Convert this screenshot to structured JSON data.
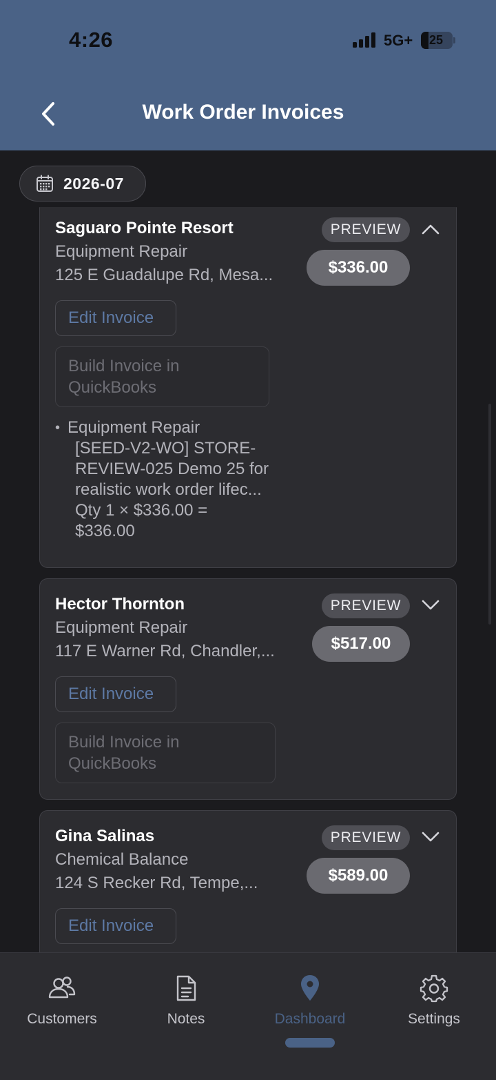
{
  "status_bar": {
    "time": "4:26",
    "network": "5G+",
    "battery": "25"
  },
  "header": {
    "title": "Work Order Invoices"
  },
  "filter": {
    "month": "2026-07"
  },
  "invoices": [
    {
      "name": "Saguaro Pointe Resort",
      "service": "Equipment Repair",
      "address": "125 E Guadalupe Rd, Mesa...",
      "status": "PREVIEW",
      "amount": "$336.00",
      "expanded": true,
      "edit_label": "Edit Invoice",
      "build_label": "Build Invoice in\nQuickBooks",
      "line_items": [
        {
          "title": "Equipment Repair",
          "detail": "[SEED-V2-WO] STORE-\nREVIEW-025 Demo 25 for\nrealistic work order lifec...\nQty 1 × $336.00 =\n$336.00"
        }
      ]
    },
    {
      "name": "Hector Thornton",
      "service": "Equipment Repair",
      "address": "117 E Warner Rd, Chandler,...",
      "status": "PREVIEW",
      "amount": "$517.00",
      "expanded": false,
      "edit_label": "Edit Invoice",
      "build_label": "Build Invoice in\nQuickBooks"
    },
    {
      "name": "Gina Salinas",
      "service": "Chemical Balance",
      "address": "124 S Recker Rd, Tempe,...",
      "status": "PREVIEW",
      "amount": "$589.00",
      "expanded": false,
      "edit_label": "Edit Invoice"
    }
  ],
  "nav": {
    "items": [
      {
        "label": "Customers",
        "icon": "users-icon"
      },
      {
        "label": "Notes",
        "icon": "document-icon"
      },
      {
        "label": "Dashboard",
        "icon": "map-pin-icon",
        "active": true
      },
      {
        "label": "Settings",
        "icon": "gear-icon"
      }
    ]
  },
  "colors": {
    "accent": "#4a6286",
    "link": "#5d79a4",
    "background": "#1b1b1e",
    "card": "#2c2c30"
  }
}
